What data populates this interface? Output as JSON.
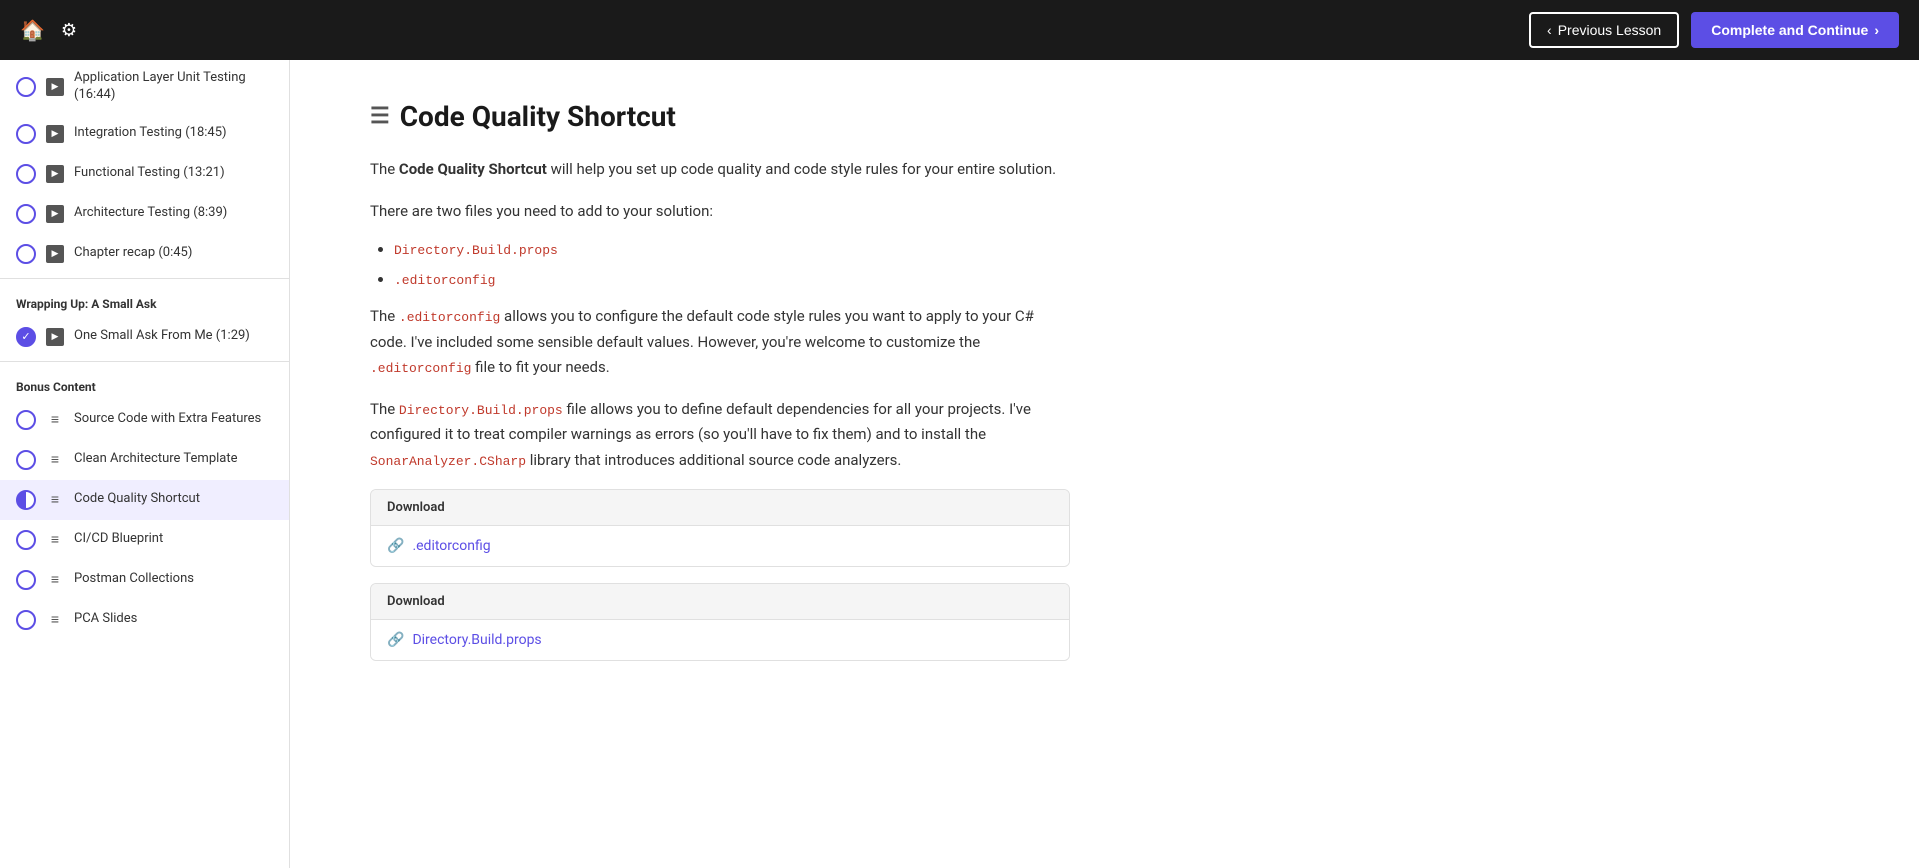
{
  "topNav": {
    "prevLabel": "Previous Lesson",
    "completeLabel": "Complete and Continue"
  },
  "sidebar": {
    "sections": [
      {
        "label": "",
        "items": [
          {
            "id": "app-unit-testing",
            "type": "video",
            "status": "incomplete",
            "text": "Application Layer Unit Testing (16:44)"
          },
          {
            "id": "integration-testing",
            "type": "video",
            "status": "incomplete",
            "text": "Integration Testing (18:45)"
          },
          {
            "id": "functional-testing",
            "type": "video",
            "status": "incomplete",
            "text": "Functional Testing (13:21)"
          },
          {
            "id": "architecture-testing",
            "type": "video",
            "status": "incomplete",
            "text": "Architecture Testing (8:39)"
          },
          {
            "id": "chapter-recap",
            "type": "video",
            "status": "incomplete",
            "text": "Chapter recap (0:45)"
          }
        ]
      },
      {
        "label": "Wrapping Up: A Small Ask",
        "items": [
          {
            "id": "one-small-ask",
            "type": "video",
            "status": "completed",
            "text": "One Small Ask From Me (1:29)"
          }
        ]
      },
      {
        "label": "Bonus Content",
        "items": [
          {
            "id": "source-code-extra",
            "type": "text",
            "status": "incomplete",
            "text": "Source Code with Extra Features"
          },
          {
            "id": "clean-architecture-template",
            "type": "text",
            "status": "incomplete",
            "text": "Clean Architecture Template"
          },
          {
            "id": "code-quality-shortcut",
            "type": "text",
            "status": "half",
            "text": "Code Quality Shortcut"
          },
          {
            "id": "ci-cd-blueprint",
            "type": "text",
            "status": "incomplete",
            "text": "CI/CD Blueprint"
          },
          {
            "id": "postman-collections",
            "type": "text",
            "status": "incomplete",
            "text": "Postman Collections"
          },
          {
            "id": "pca-slides",
            "type": "text",
            "status": "incomplete",
            "text": "PCA Slides"
          }
        ]
      }
    ]
  },
  "content": {
    "title": "Code Quality Shortcut",
    "para1_prefix": "The ",
    "para1_bold": "Code Quality Shortcut",
    "para1_suffix": " will help you set up code quality and code style rules for your entire solution.",
    "para2": "There are two files you need to add to your solution:",
    "bullet1": "Directory.Build.props",
    "bullet2": ".editorconfig",
    "para3_prefix": "The ",
    "para3_code": ".editorconfig",
    "para3_suffix": " allows you to configure the default code style rules you want to apply to your C# code. I've included some sensible default values. However, you're welcome to customize the ",
    "para3_code2": ".editorconfig",
    "para3_suffix2": " file to fit your needs.",
    "para4_prefix": "The ",
    "para4_code": "Directory.Build.props",
    "para4_suffix": " file allows you to define default dependencies for all your projects. I've configured it to treat compiler warnings as errors (so you'll have to fix them) and to install the ",
    "para4_code2": "SonarAnalyzer.CSharp",
    "para4_suffix2": " library that introduces additional source code analyzers.",
    "download1": {
      "header": "Download",
      "linkText": ".editorconfig"
    },
    "download2": {
      "header": "Download",
      "linkText": "Directory.Build.props"
    }
  }
}
